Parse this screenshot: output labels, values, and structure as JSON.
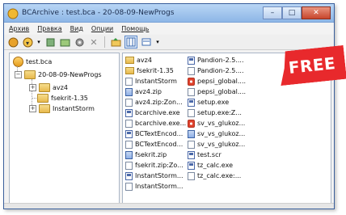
{
  "window": {
    "title": "BCArchive : test.bca - 20-08-09-NewProgs"
  },
  "menu": [
    "Архив",
    "Правка",
    "Вид",
    "Опции",
    "Помощь"
  ],
  "tree": {
    "root": "test.bca",
    "child": "20-08-09-NewProgs",
    "leaves": [
      "avz4",
      "fsekrit-1.35",
      "InstantStorm"
    ]
  },
  "files": {
    "col1": [
      "avz4",
      "fsekrit-1.35",
      "InstantStorm",
      "avz4.zip",
      "avz4.zip:Zon...",
      "bcarchive.exe",
      "bcarchive.exe...",
      "BCTextEncod...",
      "BCTextEncod...",
      "fsekrit.zip",
      "fsekrit.zip:Zo...",
      "InstantStorm...",
      "InstantStorm..."
    ],
    "col2": [
      "Pandion-2.5....",
      "Pandion-2.5....",
      "pepsi_global....",
      "pepsi_global....",
      "setup.exe",
      "setup.exe:Z...",
      "sv_vs_glukoz...",
      "sv_vs_glukoz...",
      "sv_vs_glukoz...",
      "test.scr",
      "tz_calc.exe",
      "tz_calc.exe:..."
    ]
  },
  "badge": {
    "text": "FREE",
    "color": "#e8292c"
  }
}
